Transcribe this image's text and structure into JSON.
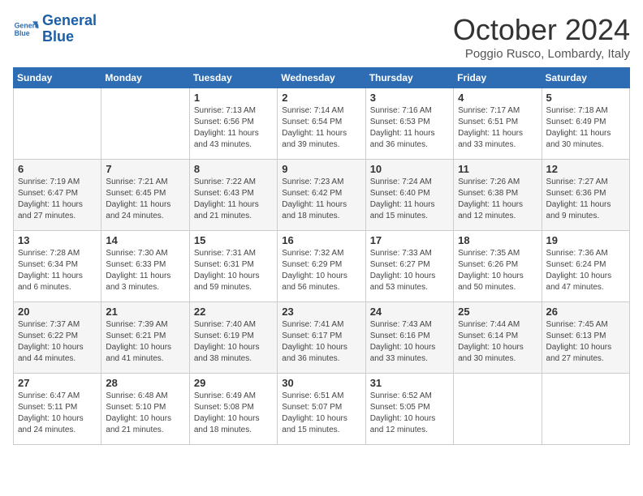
{
  "header": {
    "logo_line1": "General",
    "logo_line2": "Blue",
    "month": "October 2024",
    "location": "Poggio Rusco, Lombardy, Italy"
  },
  "days_of_week": [
    "Sunday",
    "Monday",
    "Tuesday",
    "Wednesday",
    "Thursday",
    "Friday",
    "Saturday"
  ],
  "weeks": [
    [
      {
        "day": "",
        "info": ""
      },
      {
        "day": "",
        "info": ""
      },
      {
        "day": "1",
        "info": "Sunrise: 7:13 AM\nSunset: 6:56 PM\nDaylight: 11 hours and 43 minutes."
      },
      {
        "day": "2",
        "info": "Sunrise: 7:14 AM\nSunset: 6:54 PM\nDaylight: 11 hours and 39 minutes."
      },
      {
        "day": "3",
        "info": "Sunrise: 7:16 AM\nSunset: 6:53 PM\nDaylight: 11 hours and 36 minutes."
      },
      {
        "day": "4",
        "info": "Sunrise: 7:17 AM\nSunset: 6:51 PM\nDaylight: 11 hours and 33 minutes."
      },
      {
        "day": "5",
        "info": "Sunrise: 7:18 AM\nSunset: 6:49 PM\nDaylight: 11 hours and 30 minutes."
      }
    ],
    [
      {
        "day": "6",
        "info": "Sunrise: 7:19 AM\nSunset: 6:47 PM\nDaylight: 11 hours and 27 minutes."
      },
      {
        "day": "7",
        "info": "Sunrise: 7:21 AM\nSunset: 6:45 PM\nDaylight: 11 hours and 24 minutes."
      },
      {
        "day": "8",
        "info": "Sunrise: 7:22 AM\nSunset: 6:43 PM\nDaylight: 11 hours and 21 minutes."
      },
      {
        "day": "9",
        "info": "Sunrise: 7:23 AM\nSunset: 6:42 PM\nDaylight: 11 hours and 18 minutes."
      },
      {
        "day": "10",
        "info": "Sunrise: 7:24 AM\nSunset: 6:40 PM\nDaylight: 11 hours and 15 minutes."
      },
      {
        "day": "11",
        "info": "Sunrise: 7:26 AM\nSunset: 6:38 PM\nDaylight: 11 hours and 12 minutes."
      },
      {
        "day": "12",
        "info": "Sunrise: 7:27 AM\nSunset: 6:36 PM\nDaylight: 11 hours and 9 minutes."
      }
    ],
    [
      {
        "day": "13",
        "info": "Sunrise: 7:28 AM\nSunset: 6:34 PM\nDaylight: 11 hours and 6 minutes."
      },
      {
        "day": "14",
        "info": "Sunrise: 7:30 AM\nSunset: 6:33 PM\nDaylight: 11 hours and 3 minutes."
      },
      {
        "day": "15",
        "info": "Sunrise: 7:31 AM\nSunset: 6:31 PM\nDaylight: 10 hours and 59 minutes."
      },
      {
        "day": "16",
        "info": "Sunrise: 7:32 AM\nSunset: 6:29 PM\nDaylight: 10 hours and 56 minutes."
      },
      {
        "day": "17",
        "info": "Sunrise: 7:33 AM\nSunset: 6:27 PM\nDaylight: 10 hours and 53 minutes."
      },
      {
        "day": "18",
        "info": "Sunrise: 7:35 AM\nSunset: 6:26 PM\nDaylight: 10 hours and 50 minutes."
      },
      {
        "day": "19",
        "info": "Sunrise: 7:36 AM\nSunset: 6:24 PM\nDaylight: 10 hours and 47 minutes."
      }
    ],
    [
      {
        "day": "20",
        "info": "Sunrise: 7:37 AM\nSunset: 6:22 PM\nDaylight: 10 hours and 44 minutes."
      },
      {
        "day": "21",
        "info": "Sunrise: 7:39 AM\nSunset: 6:21 PM\nDaylight: 10 hours and 41 minutes."
      },
      {
        "day": "22",
        "info": "Sunrise: 7:40 AM\nSunset: 6:19 PM\nDaylight: 10 hours and 38 minutes."
      },
      {
        "day": "23",
        "info": "Sunrise: 7:41 AM\nSunset: 6:17 PM\nDaylight: 10 hours and 36 minutes."
      },
      {
        "day": "24",
        "info": "Sunrise: 7:43 AM\nSunset: 6:16 PM\nDaylight: 10 hours and 33 minutes."
      },
      {
        "day": "25",
        "info": "Sunrise: 7:44 AM\nSunset: 6:14 PM\nDaylight: 10 hours and 30 minutes."
      },
      {
        "day": "26",
        "info": "Sunrise: 7:45 AM\nSunset: 6:13 PM\nDaylight: 10 hours and 27 minutes."
      }
    ],
    [
      {
        "day": "27",
        "info": "Sunrise: 6:47 AM\nSunset: 5:11 PM\nDaylight: 10 hours and 24 minutes."
      },
      {
        "day": "28",
        "info": "Sunrise: 6:48 AM\nSunset: 5:10 PM\nDaylight: 10 hours and 21 minutes."
      },
      {
        "day": "29",
        "info": "Sunrise: 6:49 AM\nSunset: 5:08 PM\nDaylight: 10 hours and 18 minutes."
      },
      {
        "day": "30",
        "info": "Sunrise: 6:51 AM\nSunset: 5:07 PM\nDaylight: 10 hours and 15 minutes."
      },
      {
        "day": "31",
        "info": "Sunrise: 6:52 AM\nSunset: 5:05 PM\nDaylight: 10 hours and 12 minutes."
      },
      {
        "day": "",
        "info": ""
      },
      {
        "day": "",
        "info": ""
      }
    ]
  ]
}
